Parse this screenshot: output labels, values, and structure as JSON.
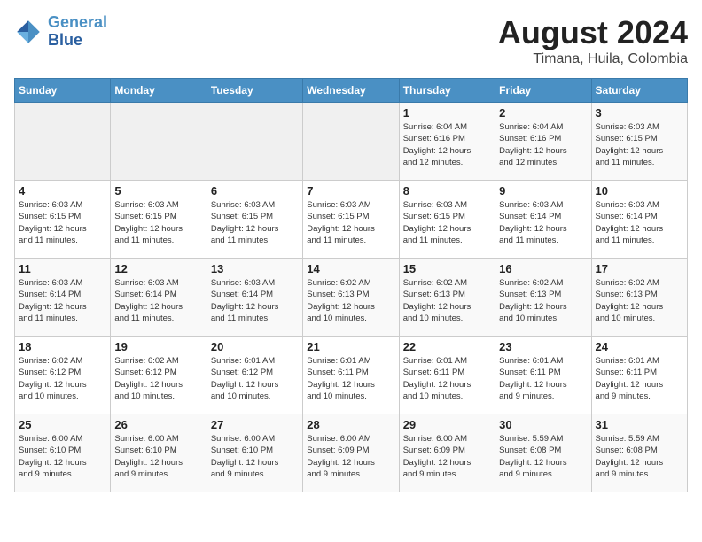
{
  "logo": {
    "line1": "General",
    "line2": "Blue"
  },
  "title": "August 2024",
  "subtitle": "Timana, Huila, Colombia",
  "weekdays": [
    "Sunday",
    "Monday",
    "Tuesday",
    "Wednesday",
    "Thursday",
    "Friday",
    "Saturday"
  ],
  "weeks": [
    [
      {
        "day": "",
        "info": ""
      },
      {
        "day": "",
        "info": ""
      },
      {
        "day": "",
        "info": ""
      },
      {
        "day": "",
        "info": ""
      },
      {
        "day": "1",
        "info": "Sunrise: 6:04 AM\nSunset: 6:16 PM\nDaylight: 12 hours\nand 12 minutes."
      },
      {
        "day": "2",
        "info": "Sunrise: 6:04 AM\nSunset: 6:16 PM\nDaylight: 12 hours\nand 12 minutes."
      },
      {
        "day": "3",
        "info": "Sunrise: 6:03 AM\nSunset: 6:15 PM\nDaylight: 12 hours\nand 11 minutes."
      }
    ],
    [
      {
        "day": "4",
        "info": "Sunrise: 6:03 AM\nSunset: 6:15 PM\nDaylight: 12 hours\nand 11 minutes."
      },
      {
        "day": "5",
        "info": "Sunrise: 6:03 AM\nSunset: 6:15 PM\nDaylight: 12 hours\nand 11 minutes."
      },
      {
        "day": "6",
        "info": "Sunrise: 6:03 AM\nSunset: 6:15 PM\nDaylight: 12 hours\nand 11 minutes."
      },
      {
        "day": "7",
        "info": "Sunrise: 6:03 AM\nSunset: 6:15 PM\nDaylight: 12 hours\nand 11 minutes."
      },
      {
        "day": "8",
        "info": "Sunrise: 6:03 AM\nSunset: 6:15 PM\nDaylight: 12 hours\nand 11 minutes."
      },
      {
        "day": "9",
        "info": "Sunrise: 6:03 AM\nSunset: 6:14 PM\nDaylight: 12 hours\nand 11 minutes."
      },
      {
        "day": "10",
        "info": "Sunrise: 6:03 AM\nSunset: 6:14 PM\nDaylight: 12 hours\nand 11 minutes."
      }
    ],
    [
      {
        "day": "11",
        "info": "Sunrise: 6:03 AM\nSunset: 6:14 PM\nDaylight: 12 hours\nand 11 minutes."
      },
      {
        "day": "12",
        "info": "Sunrise: 6:03 AM\nSunset: 6:14 PM\nDaylight: 12 hours\nand 11 minutes."
      },
      {
        "day": "13",
        "info": "Sunrise: 6:03 AM\nSunset: 6:14 PM\nDaylight: 12 hours\nand 11 minutes."
      },
      {
        "day": "14",
        "info": "Sunrise: 6:02 AM\nSunset: 6:13 PM\nDaylight: 12 hours\nand 10 minutes."
      },
      {
        "day": "15",
        "info": "Sunrise: 6:02 AM\nSunset: 6:13 PM\nDaylight: 12 hours\nand 10 minutes."
      },
      {
        "day": "16",
        "info": "Sunrise: 6:02 AM\nSunset: 6:13 PM\nDaylight: 12 hours\nand 10 minutes."
      },
      {
        "day": "17",
        "info": "Sunrise: 6:02 AM\nSunset: 6:13 PM\nDaylight: 12 hours\nand 10 minutes."
      }
    ],
    [
      {
        "day": "18",
        "info": "Sunrise: 6:02 AM\nSunset: 6:12 PM\nDaylight: 12 hours\nand 10 minutes."
      },
      {
        "day": "19",
        "info": "Sunrise: 6:02 AM\nSunset: 6:12 PM\nDaylight: 12 hours\nand 10 minutes."
      },
      {
        "day": "20",
        "info": "Sunrise: 6:01 AM\nSunset: 6:12 PM\nDaylight: 12 hours\nand 10 minutes."
      },
      {
        "day": "21",
        "info": "Sunrise: 6:01 AM\nSunset: 6:11 PM\nDaylight: 12 hours\nand 10 minutes."
      },
      {
        "day": "22",
        "info": "Sunrise: 6:01 AM\nSunset: 6:11 PM\nDaylight: 12 hours\nand 10 minutes."
      },
      {
        "day": "23",
        "info": "Sunrise: 6:01 AM\nSunset: 6:11 PM\nDaylight: 12 hours\nand 9 minutes."
      },
      {
        "day": "24",
        "info": "Sunrise: 6:01 AM\nSunset: 6:11 PM\nDaylight: 12 hours\nand 9 minutes."
      }
    ],
    [
      {
        "day": "25",
        "info": "Sunrise: 6:00 AM\nSunset: 6:10 PM\nDaylight: 12 hours\nand 9 minutes."
      },
      {
        "day": "26",
        "info": "Sunrise: 6:00 AM\nSunset: 6:10 PM\nDaylight: 12 hours\nand 9 minutes."
      },
      {
        "day": "27",
        "info": "Sunrise: 6:00 AM\nSunset: 6:10 PM\nDaylight: 12 hours\nand 9 minutes."
      },
      {
        "day": "28",
        "info": "Sunrise: 6:00 AM\nSunset: 6:09 PM\nDaylight: 12 hours\nand 9 minutes."
      },
      {
        "day": "29",
        "info": "Sunrise: 6:00 AM\nSunset: 6:09 PM\nDaylight: 12 hours\nand 9 minutes."
      },
      {
        "day": "30",
        "info": "Sunrise: 5:59 AM\nSunset: 6:08 PM\nDaylight: 12 hours\nand 9 minutes."
      },
      {
        "day": "31",
        "info": "Sunrise: 5:59 AM\nSunset: 6:08 PM\nDaylight: 12 hours\nand 9 minutes."
      }
    ]
  ]
}
